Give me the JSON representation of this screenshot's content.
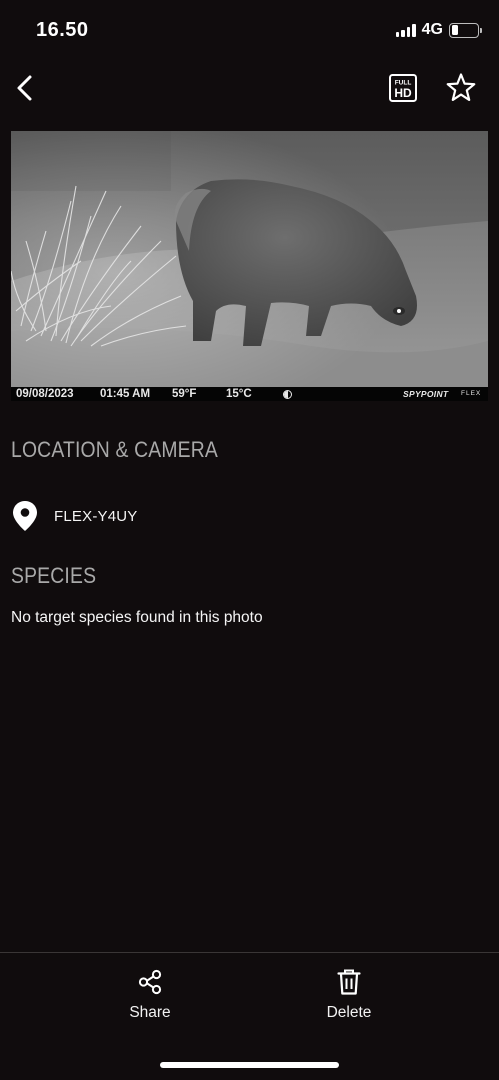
{
  "status_bar": {
    "time": "16.50",
    "network": "4G",
    "signal_icon": "cellular-signal-icon",
    "battery_icon": "battery-icon",
    "battery_level": 0.25
  },
  "header": {
    "back_icon": "chevron-left-icon",
    "hd_icon": "full-hd-icon",
    "hd_icon_text": [
      "FULL",
      "HD"
    ],
    "favorite_icon": "star-icon"
  },
  "photo": {
    "subject": "night infrared trail camera photo",
    "stamp": {
      "date": "09/08/2023",
      "time": "01:45 AM",
      "temp_f": "59°F",
      "temp_c": "15°C",
      "moon_icon": "moon-phase-icon",
      "brand": "SPYPOINT",
      "model": "FLEX"
    }
  },
  "location_section": {
    "title": "LOCATION & CAMERA",
    "pin_icon": "location-pin-icon",
    "camera_name": "FLEX-Y4UY"
  },
  "species_section": {
    "title": "SPECIES",
    "text": "No target species found in this photo"
  },
  "bottom_bar": {
    "share": {
      "label": "Share",
      "icon": "share-icon"
    },
    "delete": {
      "label": "Delete",
      "icon": "trash-icon"
    }
  },
  "colors": {
    "background": "#100c0d",
    "section_title": "#a9a9a9",
    "text": "#f5f5f5",
    "divider": "#3a3636"
  }
}
